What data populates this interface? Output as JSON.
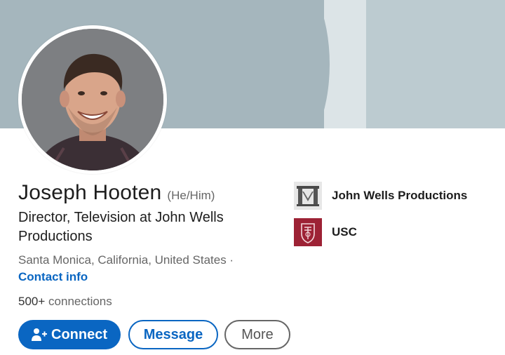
{
  "profile": {
    "name": "Joseph Hooten",
    "pronouns": "(He/Him)",
    "headline": "Director, Television at John Wells Productions",
    "location": "Santa Monica, California, United States ·",
    "contact_info": "Contact info",
    "connections_count": "500+",
    "connections_label": "connections"
  },
  "experience": [
    {
      "name": "John Wells Productions",
      "logo": "john-wells-productions-logo"
    },
    {
      "name": "USC",
      "logo": "usc-seal-logo"
    }
  ],
  "actions": {
    "connect": "Connect",
    "message": "Message",
    "more": "More"
  },
  "colors": {
    "primary": "#0a66c2",
    "banner": "#a5b6bd",
    "usc": "#9d2235"
  }
}
